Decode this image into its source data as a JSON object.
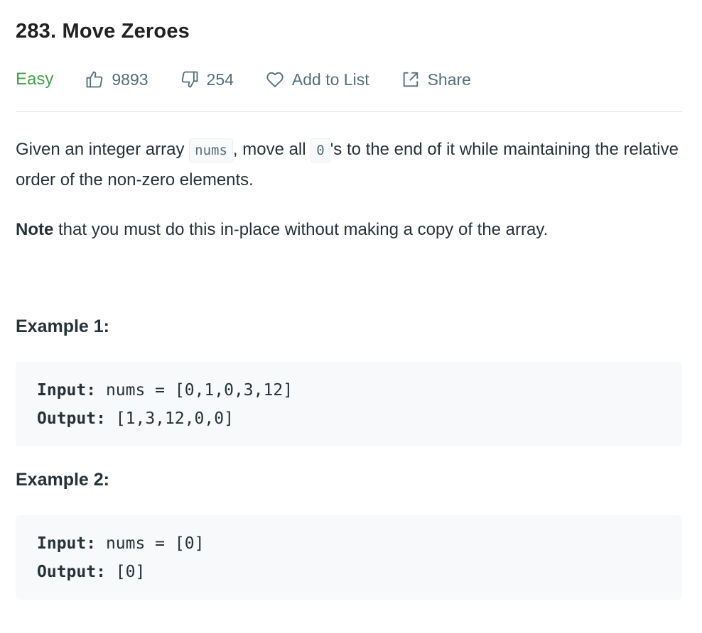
{
  "problem": {
    "title": "283. Move Zeroes",
    "difficulty": "Easy",
    "likes": "9893",
    "dislikes": "254",
    "add_to_list_label": "Add to List",
    "share_label": "Share"
  },
  "description": {
    "p1_before": "Given an integer array ",
    "p1_code1": "nums",
    "p1_mid": ", move all ",
    "p1_code2": "0",
    "p1_after": "'s to the end of it while maintaining the relative order of the non-zero elements.",
    "note_bold": "Note",
    "note_rest": " that you must do this in-place without making a copy of the array."
  },
  "examples": [
    {
      "title": "Example 1:",
      "input_label": "Input:",
      "input_value": " nums = [0,1,0,3,12]",
      "output_label": "Output:",
      "output_value": " [1,3,12,0,0]"
    },
    {
      "title": "Example 2:",
      "input_label": "Input:",
      "input_value": " nums = [0]",
      "output_label": "Output:",
      "output_value": " [0]"
    }
  ],
  "colors": {
    "easy": "#43a047",
    "meta_text": "#546e7a",
    "code_bg": "#f7f9fa"
  }
}
